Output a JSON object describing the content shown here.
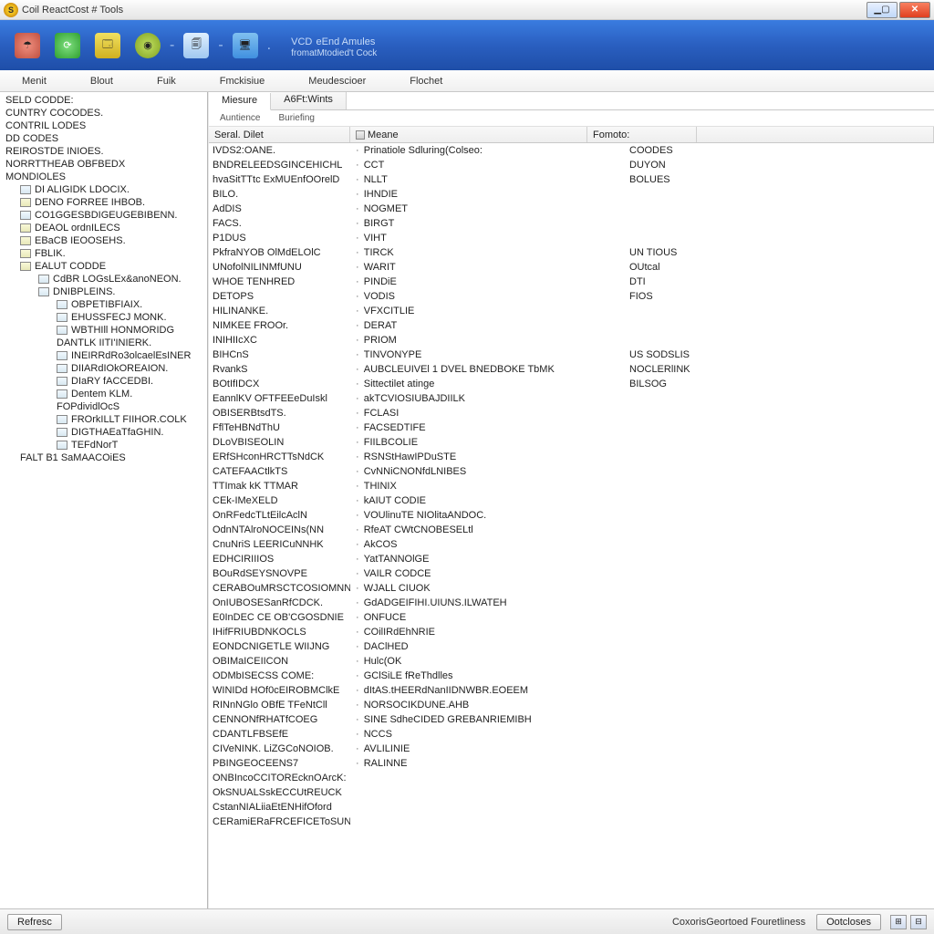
{
  "window": {
    "title": "Coil ReactCost # Tools"
  },
  "brand": {
    "title": "VCD",
    "title_sub": "eEnd Amules",
    "subtitle": "fromatMtodied't Cock"
  },
  "menu": [
    "Menit",
    "Blout",
    "Fuik",
    "Fmckisiue",
    "Meudescioer",
    "Flochet"
  ],
  "subtabs": [
    "Miesure",
    "A6Ft:Wints"
  ],
  "subtabs2": [
    "Auntience",
    "Buriefing"
  ],
  "sidebar": [
    {
      "l": 1,
      "t": "SELD CODDE:"
    },
    {
      "l": 1,
      "t": "CUNTRY COCODES."
    },
    {
      "l": 1,
      "t": "CONTRIL LODES"
    },
    {
      "l": 1,
      "t": "DD CODES"
    },
    {
      "l": 1,
      "t": "REIROSTDE INIOES."
    },
    {
      "l": 1,
      "t": "NORRTTHEAB OBFBEDX"
    },
    {
      "l": 1,
      "t": "MONDIOLES"
    },
    {
      "l": 2,
      "i": "doc",
      "t": "DI ALIGIDK LDOCIX."
    },
    {
      "l": 2,
      "i": "f",
      "t": "DENO FORREE IHBOB."
    },
    {
      "l": 2,
      "i": "doc",
      "t": "CO1GGESBDIGEUGEBIBENN."
    },
    {
      "l": 2,
      "i": "f",
      "t": "DEAOL ordnILECS"
    },
    {
      "l": 2,
      "i": "f",
      "t": "EBaCB IEOOSEHS."
    },
    {
      "l": 2,
      "i": "f",
      "t": "FBLIK."
    },
    {
      "l": 2,
      "i": "f",
      "t": "EALUT CODDE"
    },
    {
      "l": 3,
      "i": "doc",
      "t": "CdBR LOGsLEx&anoNEON."
    },
    {
      "l": 3,
      "i": "doc",
      "t": "DNIBPLEINS."
    },
    {
      "l": 4,
      "i": "doc",
      "t": "OBPETIBFIAIX."
    },
    {
      "l": 4,
      "i": "doc",
      "t": "EHUSSFECJ MONK."
    },
    {
      "l": 4,
      "i": "doc",
      "t": "WBTHIll HONMORIDG"
    },
    {
      "l": 4,
      "t": "DANTLK IITI'INIERK."
    },
    {
      "l": 4,
      "i": "doc",
      "t": "INEIRRdRo3olcaelEsINER"
    },
    {
      "l": 4,
      "i": "doc",
      "t": "DIIARdIOkOREAION."
    },
    {
      "l": 4,
      "i": "doc",
      "t": "DIaRY fACCEDBI."
    },
    {
      "l": 4,
      "i": "doc",
      "t": "Dentem KLM."
    },
    {
      "l": 4,
      "t": "FOPdividlOcS"
    },
    {
      "l": 4,
      "i": "doc",
      "t": "FROrkILLT FIIHOR.COLK"
    },
    {
      "l": 4,
      "i": "doc",
      "t": "DIGTHAEaTfaGHIN."
    },
    {
      "l": 4,
      "i": "doc",
      "t": "TEFdNorT"
    },
    {
      "l": 2,
      "t": "FALT B1 SaMAACOiES"
    }
  ],
  "col_headers": {
    "c1": "Seral. Dilet",
    "c2": "Meane",
    "c3": "Fomoto:"
  },
  "rows": [
    {
      "c1": "IVDS2:OANE.",
      "c2": "Prinatiole Sdluring(Colseo:",
      "c3": "COODES"
    },
    {
      "c1": "BNDRELEEDSGINCEHICHL",
      "c2": "CCT",
      "c3": "DUYON"
    },
    {
      "c1": "hvaSitTTtc ExMUEnfOOrelD",
      "c2": "NLLT",
      "c3": "BOLUES"
    },
    {
      "c1": "BILO.",
      "c2": "IHNDIE",
      "c3": ""
    },
    {
      "c1": "AdDIS",
      "c2": "NOGMET",
      "c3": ""
    },
    {
      "c1": "FACS.",
      "c2": "BIRGT",
      "c3": ""
    },
    {
      "c1": "P1DUS",
      "c2": "VIHT",
      "c3": ""
    },
    {
      "c1": "PkfraNYOB OlMdELOlC",
      "c2": "TIRCK",
      "c3": "UN TIOUS"
    },
    {
      "c1": "UNofolNILINMfUNU",
      "c2": "WARIT",
      "c3": "OUtcal"
    },
    {
      "c1": "WHOE TENHRED",
      "c2": "PINDiE",
      "c3": "DTI"
    },
    {
      "c1": "DETOPS",
      "c2": "VODIS",
      "c3": "FIOS"
    },
    {
      "c1": "HILINANKE.",
      "c2": "VFXCITLIE",
      "c3": ""
    },
    {
      "c1": "NIMKEE FROOr.",
      "c2": "DERAT",
      "c3": ""
    },
    {
      "c1": "INIHIIcXC",
      "c2": "PRIOM",
      "c3": ""
    },
    {
      "c1": "BIHCnS",
      "c2": "TINVONYPE",
      "c3": "US SODSLIS"
    },
    {
      "c1": "RvankS",
      "c2": "AUBCLEUIVEl 1 DVEL BNEDBOKE TbMK",
      "c3": "NOCLERlINK"
    },
    {
      "c1": "BOtIfIDCX",
      "c2": "Sittectilet atinge",
      "c3": "BILSOG"
    },
    {
      "c1": "EannlKV OFTFEEeDuIskl",
      "c2": "akTCVIOSIUBAJDIILK",
      "c3": ""
    },
    {
      "c1": "OBISERBtsdTS.",
      "c2": "FCLASI",
      "c3": ""
    },
    {
      "c1": "FflTeHBNdThU",
      "c2": "FACSEDTIFE",
      "c3": ""
    },
    {
      "c1": "DLoVBISEOLIN",
      "c2": "FIILBCOLIE",
      "c3": ""
    },
    {
      "c1": "ERfSHconHRCTTsNdCK",
      "c2": "RSNStHawIPDuSTE",
      "c3": ""
    },
    {
      "c1": "CATEFAACtlkTS",
      "c2": "CvNNiCNONfdLNIBES",
      "c3": ""
    },
    {
      "c1": "TTImak kK TTMAR",
      "c2": "THINIX",
      "c3": ""
    },
    {
      "c1": "CEk-IMeXELD",
      "c2": "kAIUT CODIE",
      "c3": ""
    },
    {
      "c1": "OnRFedcTLtEilcAclN",
      "c2": "VOUlinuTE NIOlitaANDOC.",
      "c3": ""
    },
    {
      "c1": "OdnNTAlroNOCEINs(NN",
      "c2": "RfeAT CWtCNOBESELtl",
      "c3": ""
    },
    {
      "c1": "CnuNriS LEERICuNNHK",
      "c2": "AkCOS",
      "c3": ""
    },
    {
      "c1": "EDHCIRIIIOS",
      "c2": "YatTANNOlGE",
      "c3": ""
    },
    {
      "c1": "BOuRdSEYSNOVPE",
      "c2": "VAILR CODCE",
      "c3": ""
    },
    {
      "c1": "CERABOuMRSCTCOSIOMNNODJEII",
      "c2": "WJALL CIUOK",
      "c3": ""
    },
    {
      "c1": "OnIUBOSESanRfCDCK.",
      "c2": "GdADGEIFIHI.UIUNS.ILWATEH",
      "c3": ""
    },
    {
      "c1": "E0InDEC CE OB'CGOSDNIE",
      "c2": "ONFUCE",
      "c3": ""
    },
    {
      "c1": "IHifFRIUBDNKOCLS",
      "c2": "COilIRdEhNRIE",
      "c3": ""
    },
    {
      "c1": "EONDCNIGETLE WIIJNG",
      "c2": "DAClHED",
      "c3": ""
    },
    {
      "c1": "OBIMaICEIICON",
      "c2": "Hulc(OK",
      "c3": ""
    },
    {
      "c1": "ODMbISECSS COME:",
      "c2": "GClSiLE fReThdlles",
      "c3": ""
    },
    {
      "c1": "WINIDd HOf0cEIROBMClkE",
      "c2": "dItAS.tHEERdNanIIDNWBR.EOEEM",
      "c3": ""
    },
    {
      "c1": "RINnNGlo OBfE TFeNtCll",
      "c2": "NORSOCIKDUNE.AHB",
      "c3": ""
    },
    {
      "c1": "CENNONfRHATfCOEG",
      "c2": "SINE SdheCIDED GREBANRIEMIBH",
      "c3": ""
    },
    {
      "c1": "CDANTLFBSEfE",
      "c2": "NCCS",
      "c3": ""
    },
    {
      "c1": "CIVeNINK. LiZGCoNOIOB.",
      "c2": "AVLILINIE",
      "c3": ""
    },
    {
      "c1": "PBINGEOCEENS7",
      "c2": "RALINNE",
      "c3": ""
    },
    {
      "c1": "ONBIncoCCITOREcknOArcK:",
      "c2": "",
      "c3": ""
    },
    {
      "c1": "OkSNUALSskECCUtREUCK",
      "c2": "",
      "c3": ""
    },
    {
      "c1": "CstanNIALiiaEtENHifOford",
      "c2": "",
      "c3": ""
    },
    {
      "c1": "CERamiERaFRCEFICEToSUN",
      "c2": "",
      "c3": ""
    }
  ],
  "status": {
    "refresh": "Refresc",
    "text": "CoxorisGeortoed Fouretliness",
    "close": "Ootcloses"
  }
}
